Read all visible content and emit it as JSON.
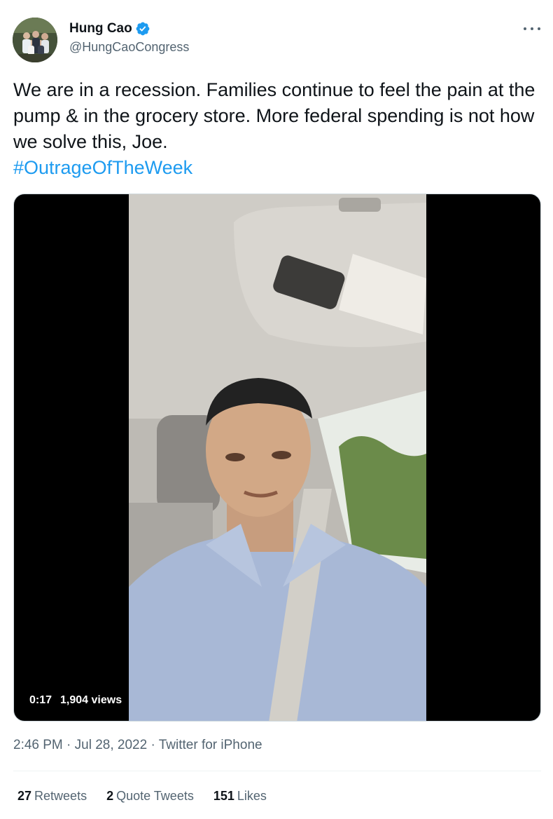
{
  "author": {
    "name": "Hung Cao",
    "handle": "@HungCaoCongress",
    "verified": true,
    "verified_icon": "verified-badge-icon",
    "avatar_icon": "family-photo-avatar"
  },
  "more_icon": "more-options-icon",
  "tweet": {
    "text": "We are in a recession. Families continue to feel the pain at the pump & in the grocery store. More federal spending is not how we solve this, Joe.",
    "hashtag": "#OutrageOfTheWeek"
  },
  "video": {
    "duration": "0:17",
    "views": "1,904 views"
  },
  "meta": {
    "time": "2:46 PM",
    "date": "Jul 28, 2022",
    "separator": "·",
    "source": "Twitter for iPhone"
  },
  "stats": {
    "retweets_count": "27",
    "retweets_label": "Retweets",
    "quotes_count": "2",
    "quotes_label": "Quote Tweets",
    "likes_count": "151",
    "likes_label": "Likes"
  },
  "colors": {
    "accent": "#1d9bf0",
    "text": "#0f1419",
    "muted": "#536471"
  }
}
